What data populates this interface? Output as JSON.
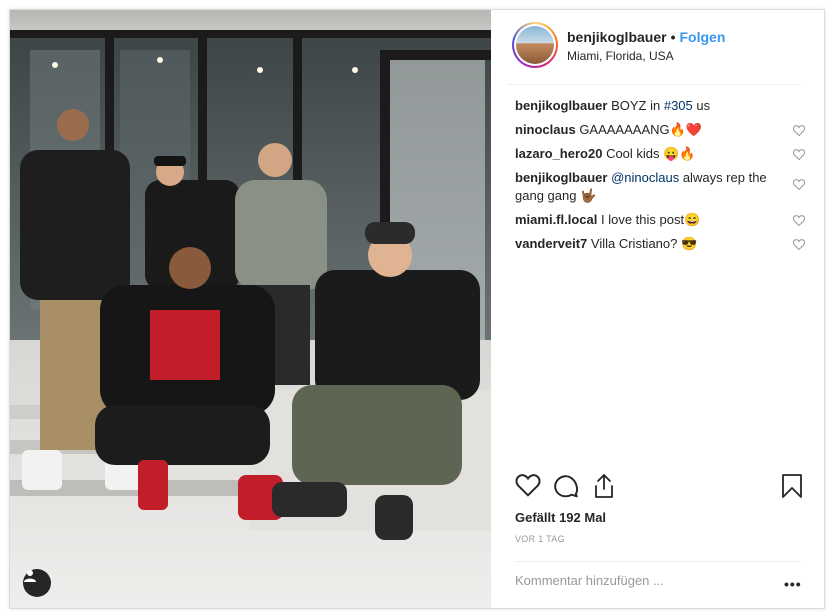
{
  "post": {
    "author": "benjikoglbauer",
    "follow_label": "Folgen",
    "location": "Miami, Florida, USA",
    "caption": {
      "user": "benjikoglbauer",
      "text_before": "BOYZ in ",
      "hashtag": "#305",
      "text_after": " us"
    },
    "comments": [
      {
        "user": "ninoclaus",
        "text": "GAAAAAAANG",
        "emoji": "🔥❤️"
      },
      {
        "user": "lazaro_hero20",
        "text": "Cool kids ",
        "emoji": "😛🔥"
      },
      {
        "user": "benjikoglbauer",
        "mention": "@ninoclaus",
        "text": " always rep the gang gang ",
        "emoji": "🤟🏾"
      },
      {
        "user": "miami.fl.local",
        "text": "I love this post",
        "emoji": "😄"
      },
      {
        "user": "vanderveit7",
        "text": "Villa Cristiano? ",
        "emoji": "😎"
      }
    ],
    "likes": "Gefällt 192 Mal",
    "time": "VOR 1 TAG",
    "comment_placeholder": "Kommentar hinzufügen ...",
    "more_label": "•••"
  },
  "icons": {
    "like": "heart-icon",
    "comment": "comment-bubble-icon",
    "share": "share-icon",
    "save": "bookmark-icon",
    "user_tag": "person-icon"
  },
  "colors": {
    "follow": "#3897f0",
    "link": "#003569",
    "muted": "#999999"
  }
}
